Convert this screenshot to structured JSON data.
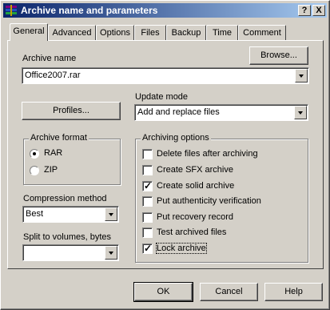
{
  "window": {
    "title": "Archive name and parameters"
  },
  "titlebar_buttons": {
    "help": "?",
    "close": "X"
  },
  "tabs": [
    {
      "label": "General"
    },
    {
      "label": "Advanced"
    },
    {
      "label": "Options"
    },
    {
      "label": "Files"
    },
    {
      "label": "Backup"
    },
    {
      "label": "Time"
    },
    {
      "label": "Comment"
    }
  ],
  "general": {
    "archive_name_label": "Archive name",
    "archive_name_value": "Office2007.rar",
    "browse_label": "Browse...",
    "profiles_label": "Profiles...",
    "update_mode_label": "Update mode",
    "update_mode_value": "Add and replace files",
    "archive_format": {
      "title": "Archive format",
      "options": [
        {
          "label": "RAR",
          "selected": true
        },
        {
          "label": "ZIP",
          "selected": false
        }
      ]
    },
    "compression_label": "Compression method",
    "compression_value": "Best",
    "split_label": "Split to volumes, bytes",
    "split_value": "",
    "archiving_options": {
      "title": "Archiving options",
      "items": [
        {
          "label": "Delete files after archiving",
          "checked": false
        },
        {
          "label": "Create SFX archive",
          "checked": false
        },
        {
          "label": "Create solid archive",
          "checked": true
        },
        {
          "label": "Put authenticity verification",
          "checked": false
        },
        {
          "label": "Put recovery record",
          "checked": false
        },
        {
          "label": "Test archived files",
          "checked": false
        },
        {
          "label": "Lock archive",
          "checked": true
        }
      ]
    }
  },
  "footer": {
    "ok": "OK",
    "cancel": "Cancel",
    "help": "Help"
  },
  "colors": {
    "face": "#d4d0c8",
    "title_start": "#0a246a",
    "title_end": "#a6caf0"
  }
}
